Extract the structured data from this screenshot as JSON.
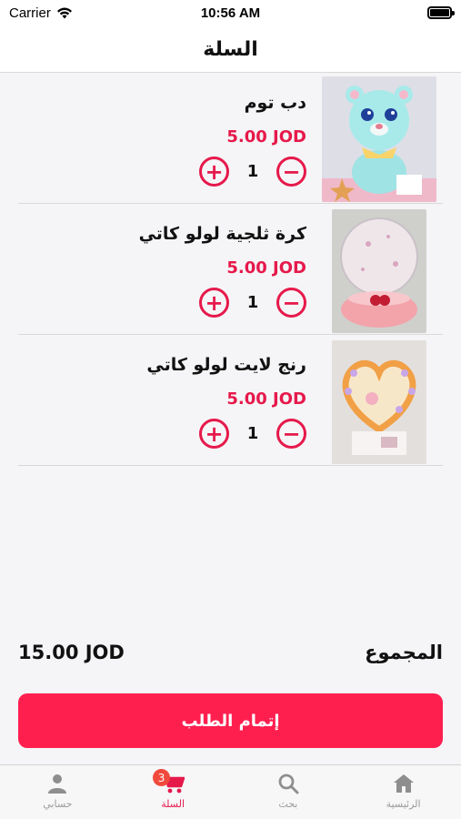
{
  "status_bar": {
    "carrier": "Carrier",
    "time": "10:56 AM"
  },
  "header": {
    "title": "السلة"
  },
  "cart": {
    "items": [
      {
        "name": "دب توم",
        "price": "5.00 JOD",
        "quantity": "1",
        "image": "teddy-bear-photo"
      },
      {
        "name": "كرة ثلجية لولو كاتي",
        "price": "5.00 JOD",
        "quantity": "1",
        "image": "snow-globe-photo"
      },
      {
        "name": "رنج لايت لولو كاتي",
        "price": "5.00 JOD",
        "quantity": "1",
        "image": "heart-ring-light-photo"
      }
    ],
    "plus_symbol": "+",
    "minus_symbol": "−"
  },
  "summary": {
    "total_label": "المجموع",
    "total_value": "15.00 JOD"
  },
  "checkout": {
    "label": "إتمام الطلب"
  },
  "tab_bar": {
    "tabs": [
      {
        "label": "الرئيسية",
        "icon": "home-icon"
      },
      {
        "label": "بحث",
        "icon": "search-icon"
      },
      {
        "label": "السلة",
        "icon": "cart-icon",
        "badge": "3",
        "active": true
      },
      {
        "label": "حسابي",
        "icon": "person-icon"
      }
    ]
  },
  "colors": {
    "accent": "#e6194b",
    "button": "#ff1f4f",
    "badge": "#f04a3c"
  }
}
